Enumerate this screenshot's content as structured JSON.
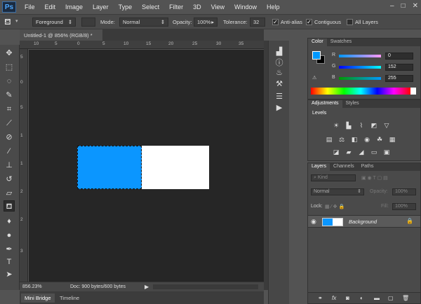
{
  "app": {
    "logo": "Ps"
  },
  "menu": [
    "File",
    "Edit",
    "Image",
    "Layer",
    "Type",
    "Select",
    "Filter",
    "3D",
    "View",
    "Window",
    "Help"
  ],
  "window_controls": [
    "–",
    "□",
    "✕"
  ],
  "options": {
    "fill_source": "Foreground",
    "mode_label": "Mode:",
    "mode_value": "Normal",
    "opacity_label": "Opacity:",
    "opacity_value": "100%",
    "tolerance_label": "Tolerance:",
    "tolerance_value": "32",
    "antialias_label": "Anti-alias",
    "contiguous_label": "Contiguous",
    "all_layers_label": "All Layers",
    "antialias_checked": true,
    "contiguous_checked": true,
    "all_layers_checked": false
  },
  "document": {
    "tab_title": "Untitled-1 @ 856% (RGB/8) *",
    "close": "×"
  },
  "ruler": {
    "h_ticks": [
      "10",
      "5",
      "0",
      "5",
      "10",
      "15",
      "20",
      "25",
      "30",
      "35"
    ],
    "v_ticks": [
      "5",
      "0",
      "5",
      "1",
      "1",
      "2",
      "2",
      "3"
    ]
  },
  "status": {
    "zoom": "856.23%",
    "doc_info": "Doc: 900 bytes/600 bytes"
  },
  "bottom_tabs": [
    "Mini Bridge",
    "Timeline"
  ],
  "color_panel": {
    "tabs": [
      "Color",
      "Swatches"
    ],
    "r_label": "R",
    "r_value": "0",
    "g_label": "G",
    "g_value": "152",
    "b_label": "B",
    "b_value": "255",
    "foreground": "#0098ff"
  },
  "adjustments_panel": {
    "tabs": [
      "Adjustments",
      "Styles"
    ],
    "heading": "Levels"
  },
  "layers_panel": {
    "tabs": [
      "Layers",
      "Channels",
      "Paths"
    ],
    "filter_label": "Kind",
    "blend_mode": "Normal",
    "opacity_label": "Opacity:",
    "opacity_value": "100%",
    "lock_label": "Lock:",
    "fill_label": "Fill:",
    "fill_value": "100%",
    "layer_name": "Background"
  },
  "colors": {
    "ui_bg": "#535353",
    "canvas_bg": "#262626",
    "accent_blue": "#0b96ff"
  }
}
